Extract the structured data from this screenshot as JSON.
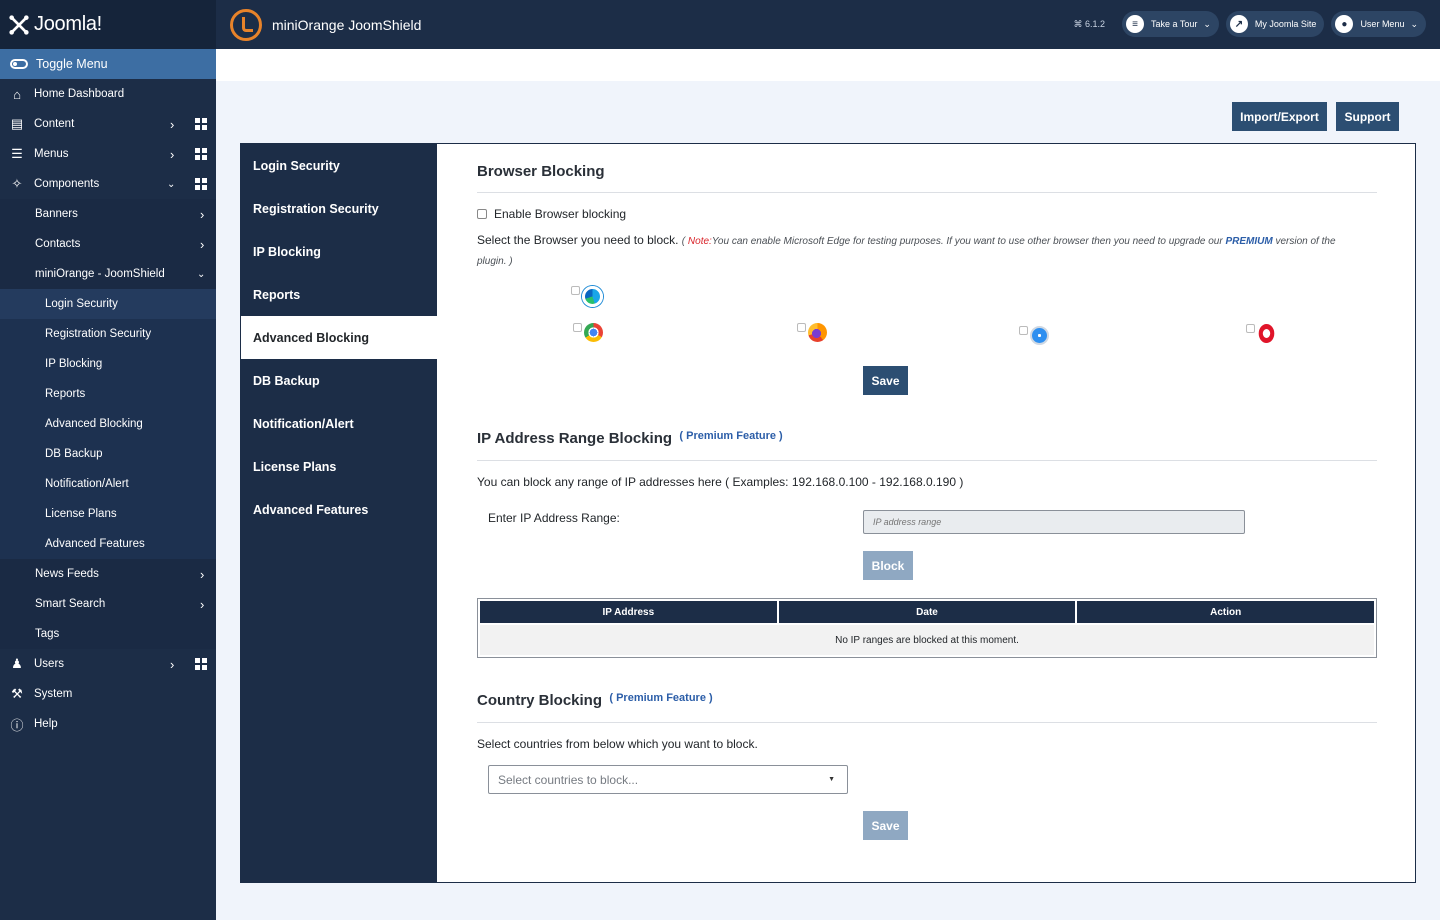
{
  "brand": {
    "name": "Joomla!"
  },
  "header": {
    "app_title": "miniOrange JoomShield",
    "version": "⌘ 6.1.2",
    "take_tour": "Take a Tour",
    "my_site": "My Joomla Site",
    "user_menu": "User Menu"
  },
  "sidebar": {
    "toggle": "Toggle Menu",
    "home": "Home Dashboard",
    "content": "Content",
    "menus": "Menus",
    "components": "Components",
    "banners": "Banners",
    "contacts": "Contacts",
    "joomshield": "miniOrange - JoomShield",
    "sub": [
      "Login Security",
      "Registration Security",
      "IP Blocking",
      "Reports",
      "Advanced Blocking",
      "DB Backup",
      "Notification/Alert",
      "License Plans",
      "Advanced Features"
    ],
    "news_feeds": "News Feeds",
    "smart_search": "Smart Search",
    "tags": "Tags",
    "users": "Users",
    "system": "System",
    "help": "Help"
  },
  "toolbar": {
    "import_export": "Import/Export",
    "support": "Support"
  },
  "tabs": [
    "Login Security",
    "Registration Security",
    "IP Blocking",
    "Reports",
    "Advanced Blocking",
    "DB Backup",
    "Notification/Alert",
    "License Plans",
    "Advanced Features"
  ],
  "browser_blocking": {
    "title": "Browser Blocking",
    "enable_label": "Enable Browser blocking",
    "select_text": "Select the Browser you need to block.",
    "note_prefix": "( ",
    "note_label": "Note:",
    "note_text": "You can enable Microsoft Edge for testing purposes. If you want to use other browser then you need to upgrade our ",
    "note_premium": "PREMIUM",
    "note_suffix": " version of the plugin. )",
    "save": "Save"
  },
  "ip_range": {
    "title": "IP Address Range Blocking",
    "premium": "( Premium Feature )",
    "description": "You can block any range of IP addresses here ( Examples: 192.168.0.100 - 192.168.0.190 )",
    "enter_label": "Enter IP Address Range:",
    "placeholder": "IP address range",
    "block": "Block",
    "table_headers": [
      "IP Address",
      "Date",
      "Action"
    ],
    "empty": "No IP ranges are blocked at this moment."
  },
  "country": {
    "title": "Country Blocking",
    "premium": "( Premium Feature )",
    "description": "Select countries from below which you want to block.",
    "placeholder": "Select countries to block...",
    "save": "Save"
  },
  "colors": {
    "navy": "#1c2d47",
    "accent": "#3d6ea3",
    "button": "#2c4e72",
    "premium": "#2c5ea8",
    "note_red": "#d9242a"
  }
}
